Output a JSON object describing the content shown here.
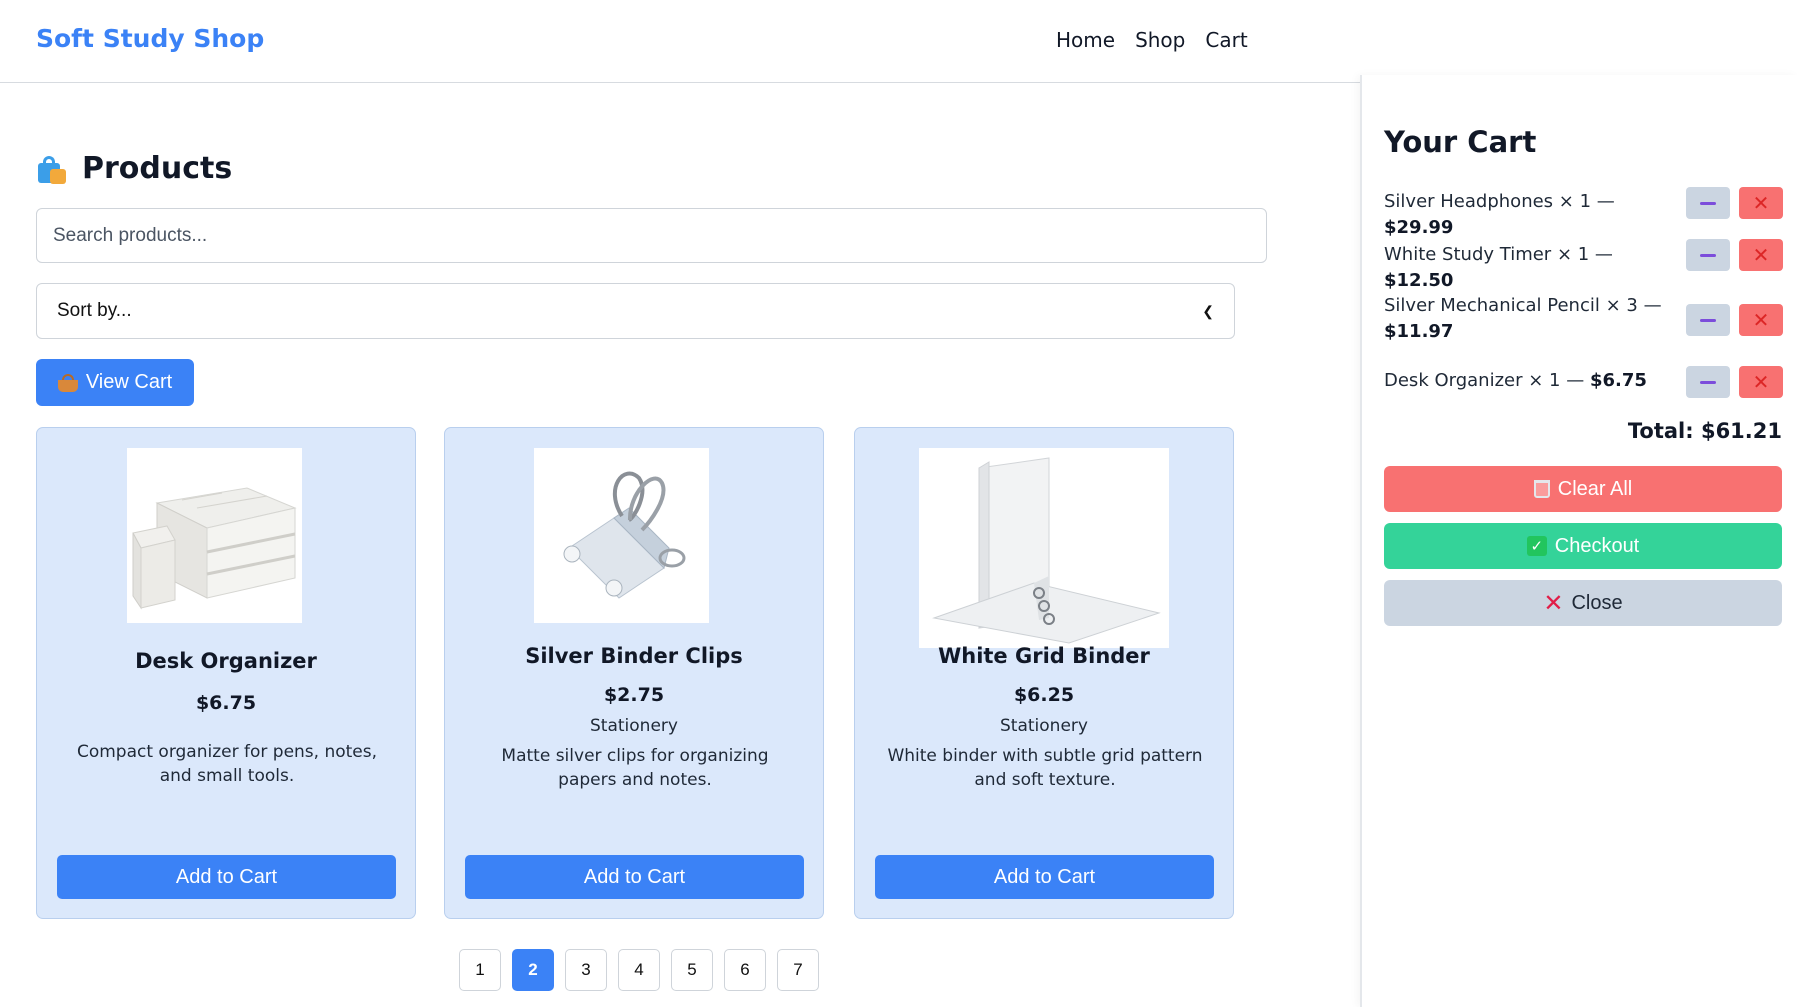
{
  "header": {
    "brand": "Soft Study Shop",
    "nav": [
      "Home",
      "Shop",
      "Cart"
    ]
  },
  "main": {
    "title": "Products",
    "search_placeholder": "Search products...",
    "sort_label": "Sort by...",
    "view_cart_label": "View Cart",
    "products": [
      {
        "name": "Desk Organizer",
        "price": "$6.75",
        "category": "",
        "description": "Compact organizer for pens, notes, and small tools.",
        "button": "Add to Cart"
      },
      {
        "name": "Silver Binder Clips",
        "price": "$2.75",
        "category": "Stationery",
        "description": "Matte silver clips for organizing papers and notes.",
        "button": "Add to Cart"
      },
      {
        "name": "White Grid Binder",
        "price": "$6.25",
        "category": "Stationery",
        "description": "White binder with subtle grid pattern and soft texture.",
        "button": "Add to Cart"
      }
    ],
    "pagination": {
      "pages": [
        "1",
        "2",
        "3",
        "4",
        "5",
        "6",
        "7"
      ],
      "active": "2"
    }
  },
  "cart": {
    "title": "Your Cart",
    "items": [
      {
        "name": "Silver Headphones",
        "qty": "× 1 —",
        "price": "$29.99"
      },
      {
        "name": "White Study Timer",
        "qty": "× 1 —",
        "price": "$12.50"
      },
      {
        "name": "Silver Mechanical Pencil",
        "qty": "× 3 —",
        "price": "$11.97"
      },
      {
        "name": "Desk Organizer",
        "qty": "× 1 —",
        "price": "$6.75"
      }
    ],
    "total": "Total: $61.21",
    "clear_label": "Clear All",
    "checkout_label": "Checkout",
    "close_label": "Close"
  },
  "colors": {
    "accent": "#3b82f6",
    "card_bg": "#dbe8fb",
    "danger": "#f87171",
    "success": "#34d399",
    "neutral": "#cbd5e1"
  },
  "icons": {
    "products": "shopping-bags-icon",
    "view_cart": "basket-icon",
    "decrease": "minus-icon",
    "remove": "close-icon",
    "clear": "trash-icon",
    "checkout": "check-icon",
    "close": "cross-icon"
  }
}
